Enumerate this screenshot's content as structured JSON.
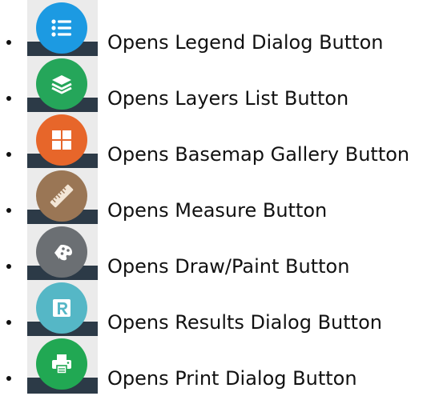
{
  "items": [
    {
      "label": "Opens Legend Dialog Button",
      "icon": "legend-list-icon",
      "color": "#1c9ae2"
    },
    {
      "label": "Opens Layers List Button",
      "icon": "layers-icon",
      "color": "#25a65a"
    },
    {
      "label": "Opens Basemap Gallery Button",
      "icon": "basemap-grid-icon",
      "color": "#e7662a"
    },
    {
      "label": "Opens Measure Button",
      "icon": "ruler-icon",
      "color": "#9a7655"
    },
    {
      "label": "Opens Draw/Paint Button",
      "icon": "palette-icon",
      "color": "#6b6f73"
    },
    {
      "label": "Opens Results Dialog Button",
      "icon": "results-r-icon",
      "color": "#55b7c6"
    },
    {
      "label": "Opens Print Dialog Button",
      "icon": "printer-icon",
      "color": "#21a853"
    }
  ]
}
